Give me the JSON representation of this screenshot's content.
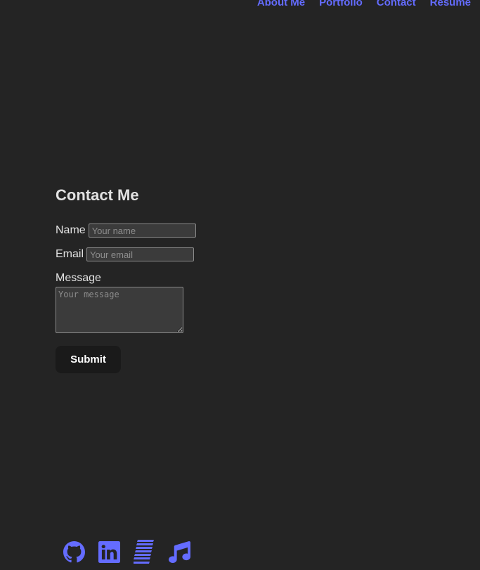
{
  "nav": {
    "items": [
      {
        "label": "About Me"
      },
      {
        "label": "Portfolio"
      },
      {
        "label": "Contact"
      },
      {
        "label": "Resume"
      }
    ]
  },
  "contact": {
    "title": "Contact Me",
    "name_label": "Name",
    "name_placeholder": "Your name",
    "email_label": "Email",
    "email_placeholder": "Your email",
    "message_label": "Message",
    "message_placeholder": "Your message",
    "submit_label": "Submit"
  },
  "footer": {
    "icons": [
      "github-icon",
      "linkedin-icon",
      "stackoverflow-icon",
      "music-icon"
    ]
  },
  "colors": {
    "background": "#242424",
    "accent": "#646cff",
    "button": "#1a1a1a",
    "input": "#3b3b3b"
  }
}
